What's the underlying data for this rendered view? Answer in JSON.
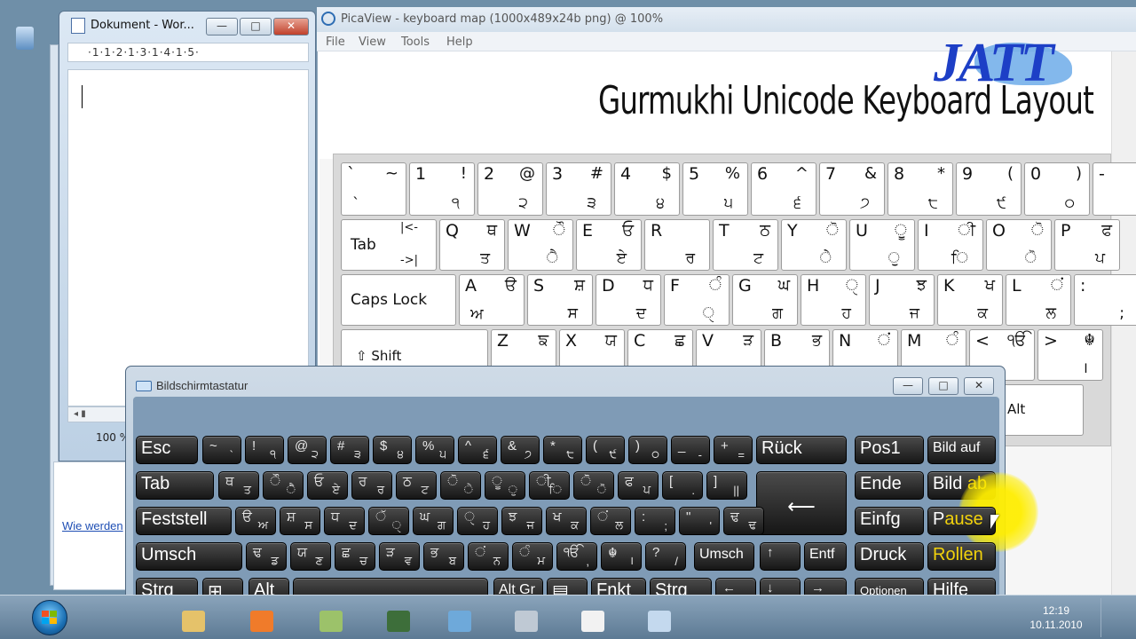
{
  "word": {
    "title": "Dokument - Wor...",
    "ruler": "·1·1·2·1·3·1·4·1·5·",
    "zoom": "100 %",
    "link_text": "Wie werden",
    "scroll_glyph": "◂ ▮"
  },
  "caption_buttons": {
    "minimize": "—",
    "maximize": "□",
    "close": "✕"
  },
  "picaview": {
    "title": "PicaView - keyboard map (1000x489x24b png) @ 100%",
    "menu": [
      "File",
      "View",
      "Tools",
      "Help"
    ],
    "image": {
      "heading": "Gurmukhi Unicode Keyboard Layout",
      "logo_text": "JATT",
      "rows": [
        [
          {
            "tl": "`",
            "tr": "~",
            "bl": "`",
            "br": ""
          },
          {
            "tl": "1",
            "tr": "!",
            "bl": "",
            "br": "੧"
          },
          {
            "tl": "2",
            "tr": "@",
            "bl": "",
            "br": "੨"
          },
          {
            "tl": "3",
            "tr": "#",
            "bl": "",
            "br": "੩"
          },
          {
            "tl": "4",
            "tr": "$",
            "bl": "",
            "br": "੪"
          },
          {
            "tl": "5",
            "tr": "%",
            "bl": "",
            "br": "੫"
          },
          {
            "tl": "6",
            "tr": "^",
            "bl": "",
            "br": "੬"
          },
          {
            "tl": "7",
            "tr": "&",
            "bl": "",
            "br": "੭"
          },
          {
            "tl": "8",
            "tr": "*",
            "bl": "",
            "br": "੮"
          },
          {
            "tl": "9",
            "tr": "(",
            "bl": "",
            "br": "੯"
          },
          {
            "tl": "0",
            "tr": ")",
            "bl": "",
            "br": "੦"
          },
          {
            "tl": "-",
            "tr": "",
            "bl": "",
            "br": ""
          }
        ],
        [
          {
            "word": "Tab",
            "tr": "|<-",
            "br": "->|"
          },
          {
            "tl": "Q",
            "tr": "ਥ",
            "bl": "",
            "br": "ਤ"
          },
          {
            "tl": "W",
            "tr": "ੌ",
            "bl": "",
            "br": "ੈ"
          },
          {
            "tl": "E",
            "tr": "ਓ",
            "bl": "",
            "br": "ਏ"
          },
          {
            "tl": "R",
            "tr": "",
            "bl": "",
            "br": "ਰ"
          },
          {
            "tl": "T",
            "tr": "ਠ",
            "bl": "",
            "br": "ਟ"
          },
          {
            "tl": "Y",
            "tr": "ੋ",
            "bl": "",
            "br": "ੇ"
          },
          {
            "tl": "U",
            "tr": "ੂ",
            "bl": "",
            "br": "ੁ"
          },
          {
            "tl": "I",
            "tr": "ੀ",
            "bl": "",
            "br": "ਿ"
          },
          {
            "tl": "O",
            "tr": "ੋ",
            "bl": "",
            "br": "ੋ"
          },
          {
            "tl": "P",
            "tr": "ਫ",
            "bl": "",
            "br": "ਪ"
          }
        ],
        [
          {
            "word": "Caps Lock"
          },
          {
            "tl": "A",
            "tr": "ੳ",
            "bl": "ਅ",
            "br": ""
          },
          {
            "tl": "S",
            "tr": "ਸ਼",
            "bl": "",
            "br": "ਸ"
          },
          {
            "tl": "D",
            "tr": "ਧ",
            "bl": "",
            "br": "ਦ"
          },
          {
            "tl": "F",
            "tr": "ੰ",
            "bl": "",
            "br": "ੑ"
          },
          {
            "tl": "G",
            "tr": "ਘ",
            "bl": "",
            "br": "ਗ"
          },
          {
            "tl": "H",
            "tr": "ੑ",
            "bl": "",
            "br": "ਹ"
          },
          {
            "tl": "J",
            "tr": "ਝ",
            "bl": "",
            "br": "ਜ"
          },
          {
            "tl": "K",
            "tr": "ਖ",
            "bl": "",
            "br": "ਕ"
          },
          {
            "tl": "L",
            "tr": "ਂ",
            "bl": "",
            "br": "ਲ"
          },
          {
            "tl": ":",
            "tr": "",
            "bl": "",
            "br": ";"
          }
        ],
        [
          {
            "word": "⇧ Shift"
          },
          {
            "tl": "Z",
            "tr": "ਙ",
            "bl": "",
            "br": ""
          },
          {
            "tl": "X",
            "tr": "ਯ",
            "bl": "",
            "br": ""
          },
          {
            "tl": "C",
            "tr": "ਛ",
            "bl": "",
            "br": ""
          },
          {
            "tl": "V",
            "tr": "ੜ",
            "bl": "",
            "br": ""
          },
          {
            "tl": "B",
            "tr": "ਭ",
            "bl": "",
            "br": ""
          },
          {
            "tl": "N",
            "tr": "ਂ",
            "bl": "",
            "br": ""
          },
          {
            "tl": "M",
            "tr": "ੰ",
            "bl": "",
            "br": ""
          },
          {
            "tl": "<",
            "tr": "ੴ",
            "bl": "",
            "br": ""
          },
          {
            "tl": ">",
            "tr": "☬",
            "bl": "",
            "br": "।"
          }
        ]
      ],
      "alt_label": "Alt"
    }
  },
  "osk": {
    "title": "Bildschirmtastatur",
    "keys": {
      "esc": "Esc",
      "back": "Rück",
      "tab": "Tab",
      "caps": "Feststell",
      "shift": "Umsch",
      "shift_r": "Umsch",
      "ctrl": "Strg",
      "ctrl_r": "Strg",
      "alt": "Alt",
      "altgr": "Alt Gr",
      "fn": "Fnkt",
      "win": "⊞",
      "menu": "▤",
      "enter": "⟵",
      "up": "↑",
      "down": "↓",
      "left": "←",
      "right": "→",
      "del": "Entf",
      "home": "Pos1",
      "pgup": "Bild auf",
      "end": "Ende",
      "pgdn_a": "Bild ",
      "pgdn_b": "ab",
      "ins": "Einfg",
      "pause_a": "P",
      "pause_b": "ause",
      "print": "Druck",
      "scroll": "Rollen",
      "options": "Optionen",
      "help": "Hilfe"
    },
    "row1": [
      [
        "~",
        "`"
      ],
      [
        "!",
        "੧"
      ],
      [
        "@",
        "੨"
      ],
      [
        "#",
        "੩"
      ],
      [
        "$",
        "੪"
      ],
      [
        "%",
        "੫"
      ],
      [
        "^",
        "੬"
      ],
      [
        "&",
        "੭"
      ],
      [
        "*",
        "੮"
      ],
      [
        "(",
        "੯"
      ],
      [
        ")",
        "੦"
      ],
      [
        "_",
        "-"
      ],
      [
        "+",
        "="
      ]
    ],
    "row2": [
      [
        "ਥ",
        "ਤ"
      ],
      [
        "ੌ",
        "ੈ"
      ],
      [
        "ਓ",
        "ਏ"
      ],
      [
        "ਰ",
        "ਰ"
      ],
      [
        "ਠ",
        "ਟ"
      ],
      [
        "ੋ",
        "ੇ"
      ],
      [
        "ੂ",
        "ੁ"
      ],
      [
        "ੀ",
        "ਿ"
      ],
      [
        "ੋ",
        "ੋ"
      ],
      [
        "ਫ",
        "ਪ"
      ],
      [
        "[",
        "."
      ],
      [
        "]",
        "||"
      ]
    ],
    "row3": [
      [
        "ੳ",
        "ਅ"
      ],
      [
        "ਸ਼",
        "ਸ"
      ],
      [
        "ਧ",
        "ਦ"
      ],
      [
        "ੱ",
        "ੑ"
      ],
      [
        "ਘ",
        "ਗ"
      ],
      [
        "ੑ",
        "ਹ"
      ],
      [
        "ਝ",
        "ਜ"
      ],
      [
        "ਖ",
        "ਕ"
      ],
      [
        "ਂ",
        "ਲ"
      ],
      [
        ":",
        ";"
      ],
      [
        "\"",
        "'"
      ],
      [
        "ਢ",
        "ਢ"
      ]
    ],
    "row4": [
      [
        "ਢ",
        "ਡ"
      ],
      [
        "ਯ",
        "ਣ"
      ],
      [
        "ਛ",
        "ਚ"
      ],
      [
        "ੜ",
        "ਵ"
      ],
      [
        "ਭ",
        "ਬ"
      ],
      [
        "ਂ",
        "ਨ"
      ],
      [
        "ੰ",
        "ਮ"
      ],
      [
        "ੴ",
        ","
      ],
      [
        "☬",
        "।"
      ],
      [
        "?",
        "/"
      ]
    ]
  },
  "taskbar": {
    "time": "12:19",
    "date": "10.11.2010"
  }
}
